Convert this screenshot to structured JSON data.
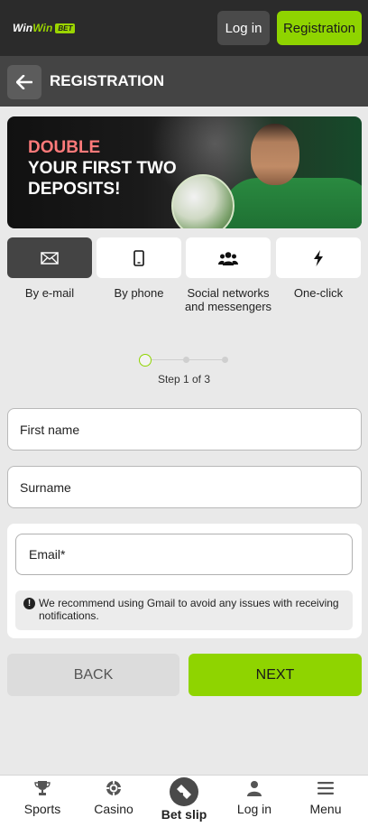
{
  "header": {
    "logo_text_a": "Win",
    "logo_text_b": "Win",
    "logo_badge": "BET",
    "login_label": "Log in",
    "registration_label": "Registration"
  },
  "subheader": {
    "title": "REGISTRATION"
  },
  "banner": {
    "line1": "DOUBLE",
    "line2": "YOUR FIRST TWO",
    "line3": "DEPOSITS!"
  },
  "methods": [
    {
      "label": "By e-mail",
      "icon": "mail-icon",
      "active": true
    },
    {
      "label": "By phone",
      "icon": "phone-icon",
      "active": false
    },
    {
      "label": "Social networks and messengers",
      "icon": "users-icon",
      "active": false
    },
    {
      "label": "One-click",
      "icon": "lightning-icon",
      "active": false
    }
  ],
  "stepper": {
    "text": "Step 1 of 3",
    "current": 1,
    "total": 3
  },
  "form": {
    "first_name": "First name",
    "surname": "Surname",
    "email": "Email*",
    "note": "We recommend using Gmail to avoid any issues with receiving notifications."
  },
  "actions": {
    "back": "BACK",
    "next": "NEXT"
  },
  "bottom_nav": [
    {
      "label": "Sports",
      "icon": "trophy-icon"
    },
    {
      "label": "Casino",
      "icon": "chip-icon"
    },
    {
      "label": "Bet slip",
      "icon": "ticket-icon"
    },
    {
      "label": "Log in",
      "icon": "user-icon"
    },
    {
      "label": "Menu",
      "icon": "hamburger-icon"
    }
  ],
  "colors": {
    "accent": "#8fd400",
    "header_bg": "#2b2b2b",
    "subheader_bg": "#444444",
    "page_bg": "#e9e9e9"
  }
}
